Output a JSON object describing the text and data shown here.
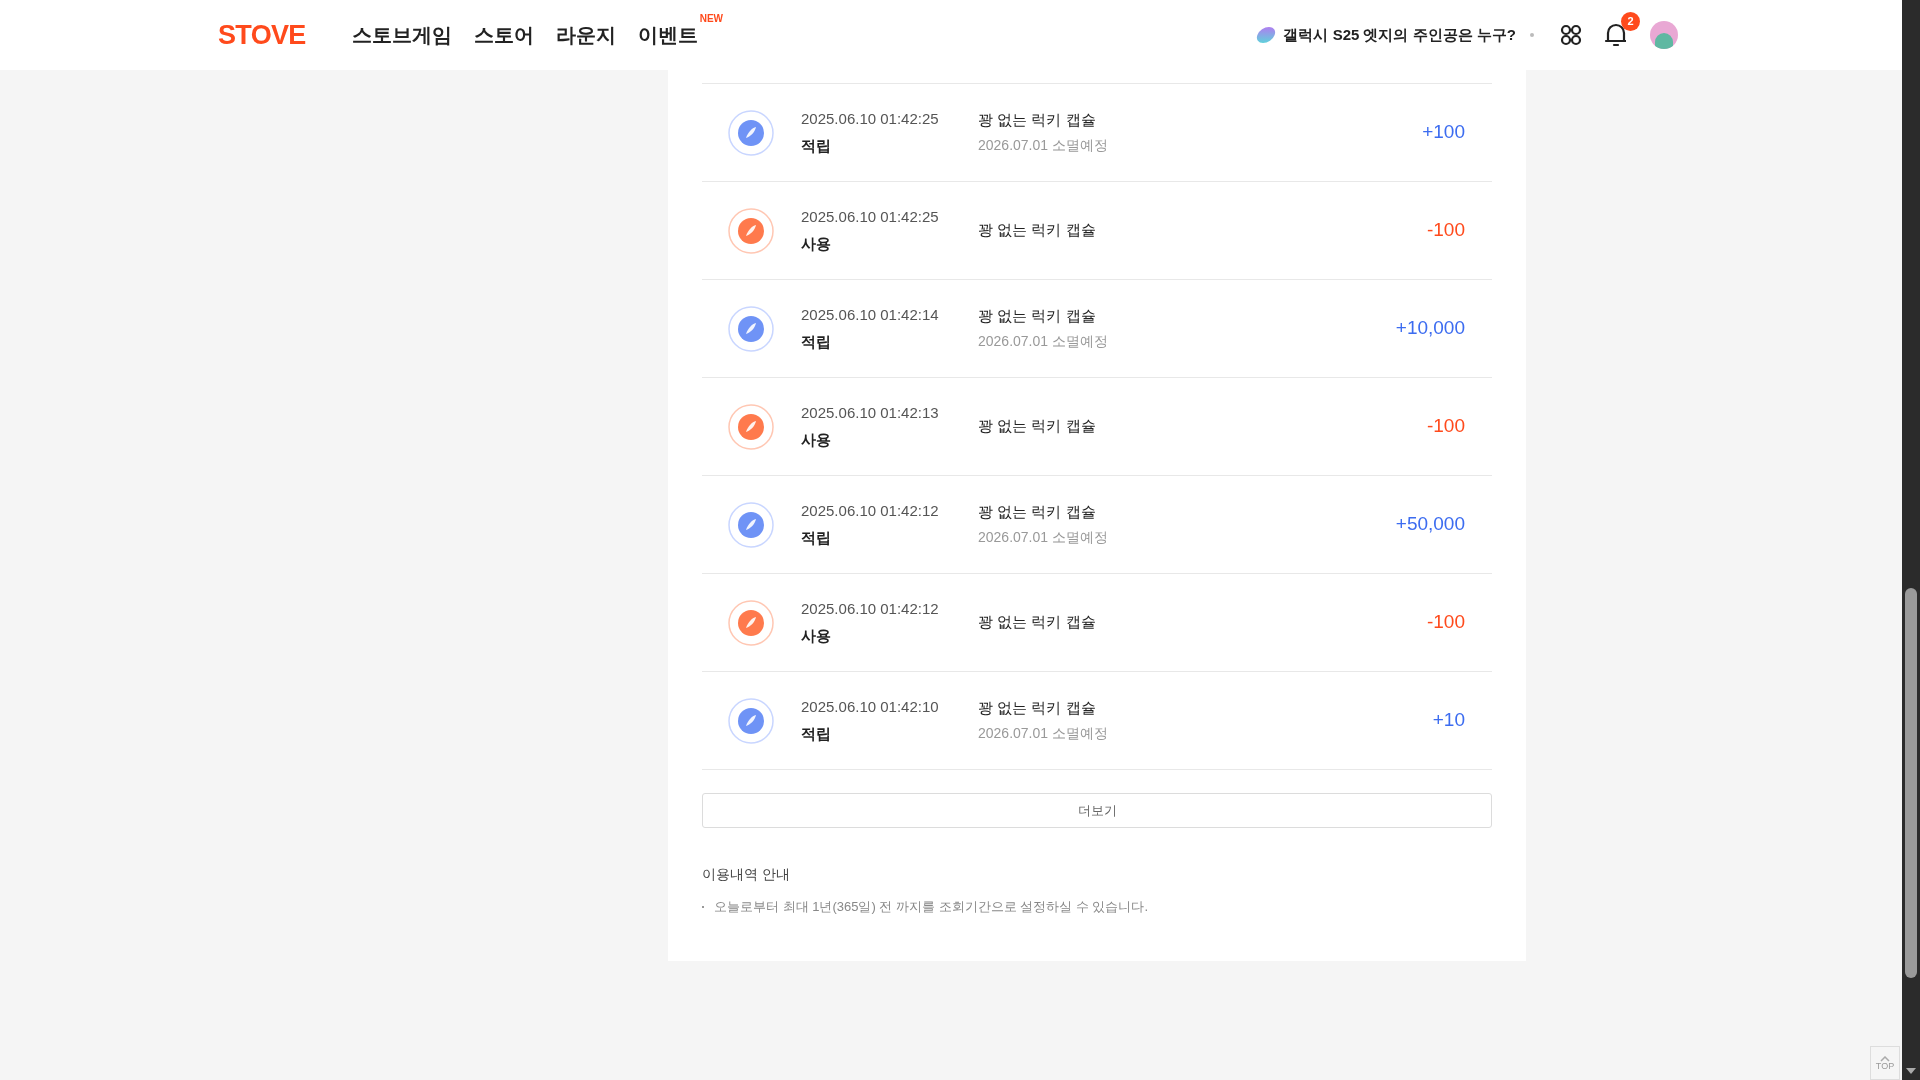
{
  "header": {
    "logo": "STOVE",
    "nav": [
      {
        "label": "스토브게임"
      },
      {
        "label": "스토어"
      },
      {
        "label": "라운지"
      },
      {
        "label": "이벤트",
        "badge": "NEW"
      }
    ],
    "promo": "갤럭시 S25 엣지의 주인공은 누구?",
    "notification_count": "2"
  },
  "history": [
    {
      "kind": "earn",
      "datetime": "2025.06.10 01:42:25",
      "type": "적립",
      "title": "꽝 없는 럭키 캡슐",
      "expiry": "2026.07.01 소멸예정",
      "amount": "+100"
    },
    {
      "kind": "use",
      "datetime": "2025.06.10 01:42:25",
      "type": "사용",
      "title": "꽝 없는 럭키 캡슐",
      "amount": "-100"
    },
    {
      "kind": "earn",
      "datetime": "2025.06.10 01:42:14",
      "type": "적립",
      "title": "꽝 없는 럭키 캡슐",
      "expiry": "2026.07.01 소멸예정",
      "amount": "+10,000"
    },
    {
      "kind": "use",
      "datetime": "2025.06.10 01:42:13",
      "type": "사용",
      "title": "꽝 없는 럭키 캡슐",
      "amount": "-100"
    },
    {
      "kind": "earn",
      "datetime": "2025.06.10 01:42:12",
      "type": "적립",
      "title": "꽝 없는 럭키 캡슐",
      "expiry": "2026.07.01 소멸예정",
      "amount": "+50,000"
    },
    {
      "kind": "use",
      "datetime": "2025.06.10 01:42:12",
      "type": "사용",
      "title": "꽝 없는 럭키 캡슐",
      "amount": "-100"
    },
    {
      "kind": "earn",
      "datetime": "2025.06.10 01:42:10",
      "type": "적립",
      "title": "꽝 없는 럭키 캡슐",
      "expiry": "2026.07.01 소멸예정",
      "amount": "+10"
    }
  ],
  "more_button": "더보기",
  "guide": {
    "title": "이용내역 안내",
    "items": [
      "오늘로부터 최대 1년(365일) 전 까지를 조회기간으로 설정하실 수 있습니다."
    ]
  },
  "top_button": "TOP"
}
